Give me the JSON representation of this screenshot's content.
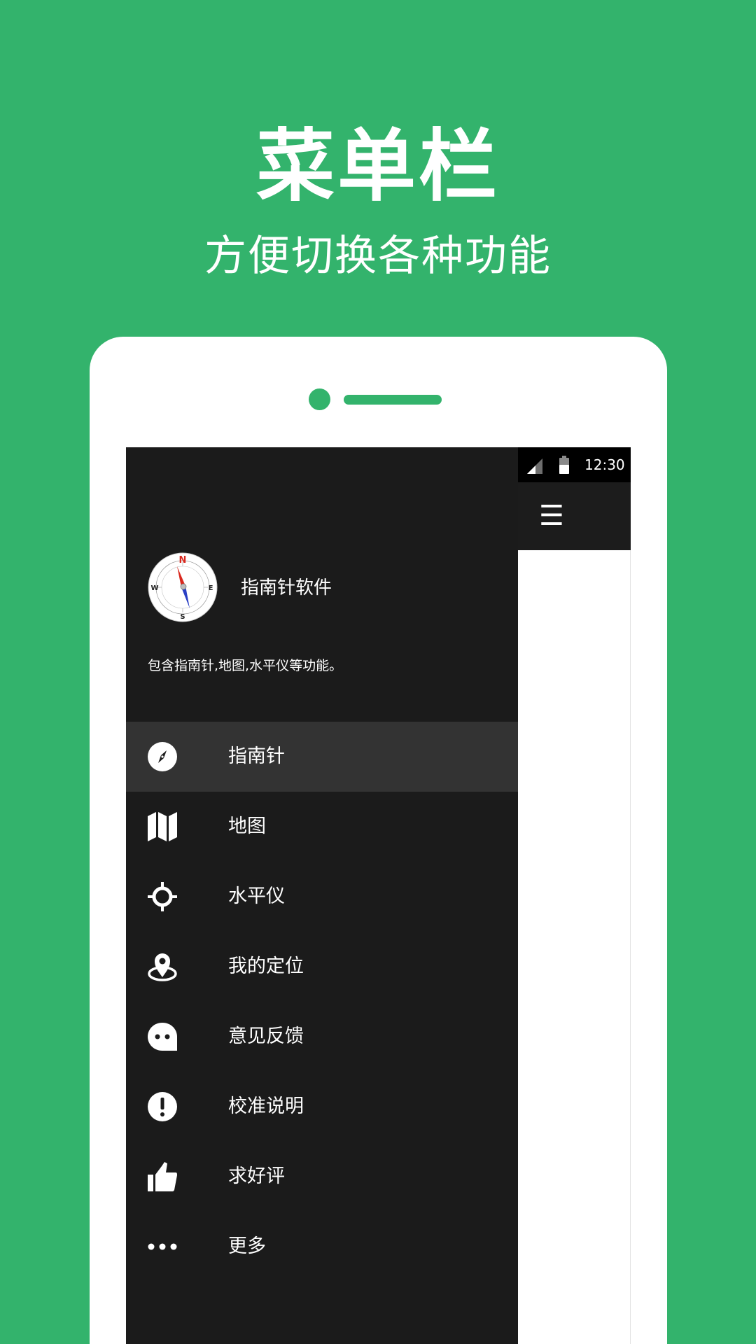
{
  "banner": {
    "title": "菜单栏",
    "subtitle": "方便切换各种功能"
  },
  "status_bar": {
    "time": "12:30",
    "icons": [
      "signal-icon",
      "battery-icon"
    ]
  },
  "app_bar": {
    "menu_icon": "☰"
  },
  "drawer": {
    "app_name": "指南针软件",
    "description": "包含指南针,地图,水平仪等功能。",
    "compass_letters": {
      "n": "N",
      "e": "E",
      "s": "S",
      "w": "W"
    },
    "items": [
      {
        "label": "指南针",
        "icon": "compass-icon",
        "active": true
      },
      {
        "label": "地图",
        "icon": "map-icon",
        "active": false
      },
      {
        "label": "水平仪",
        "icon": "crosshair-icon",
        "active": false
      },
      {
        "label": "我的定位",
        "icon": "location-pin-icon",
        "active": false
      },
      {
        "label": "意见反馈",
        "icon": "feedback-icon",
        "active": false
      },
      {
        "label": "校准说明",
        "icon": "exclamation-icon",
        "active": false
      },
      {
        "label": "求好评",
        "icon": "thumbs-up-icon",
        "active": false
      },
      {
        "label": "更多",
        "icon": "more-icon",
        "active": false
      }
    ]
  },
  "colors": {
    "background": "#33b36c",
    "drawer": "#1b1b1b",
    "active_item": "#333333",
    "compass_north": "#d9281e",
    "compass_south": "#2a3fc4"
  }
}
